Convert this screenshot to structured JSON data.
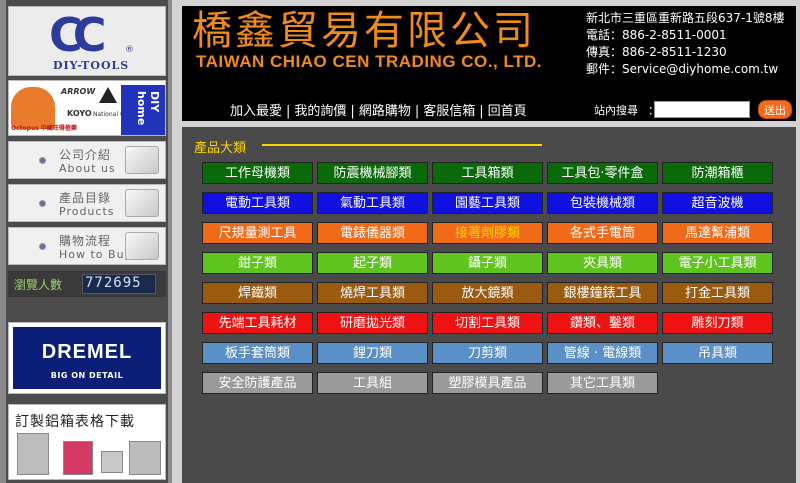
{
  "sidebar": {
    "logo_text": "DIY-TOOLS",
    "logo_mark": "CC",
    "logo_reg": "®",
    "brands": {
      "octopus": "Octopus 中國旺得蓓樂",
      "arrow": "ARROW",
      "koyo": "KOYO",
      "national": "National 松下電工",
      "diyhome": "DIY home"
    },
    "menu": [
      {
        "zh": "公司介紹",
        "en": "About us"
      },
      {
        "zh": "產品目錄",
        "en": "Products"
      },
      {
        "zh": "購物流程",
        "en": "How to Buy"
      }
    ],
    "counter_label": "瀏覽人數",
    "counter_value": "772695",
    "dremel_word": "DREMEL",
    "dremel_sub": "BIG ON DETAIL",
    "case_title": "訂製鋁箱表格下載"
  },
  "header": {
    "title_zh": "橋鑫貿易有限公司",
    "title_en": "TAIWAN CHIAO CEN TRADING CO., LTD.",
    "contact": [
      "新北市三重區重新路五段637-1號8樓",
      "電話：886-2-8511-0001",
      "傳真：886-2-8511-1230",
      "郵件：Service@diyhome.com.tw"
    ],
    "nav": [
      "加入最愛",
      "我的詢價",
      "網路購物",
      "客服信箱",
      "回首頁"
    ],
    "search_label": "站內搜尋",
    "search_colon": "：",
    "search_value": "",
    "search_button": "送出"
  },
  "content": {
    "category_title": "產品大類",
    "categories": [
      [
        "工作母機類",
        "防震機械腳類",
        "工具箱類",
        "工具包·零件盒",
        "防潮箱櫃"
      ],
      [
        "電動工具類",
        "氣動工具類",
        "園藝工具類",
        "包裝機械類",
        "超音波機"
      ],
      [
        "尺規量測工具",
        "電錶儀器類",
        "接著劑膠類",
        "各式手電筒",
        "馬達幫浦類"
      ],
      [
        "鉗子類",
        "起子類",
        "鑷子類",
        "夾具類",
        "電子小工具類"
      ],
      [
        "焊鐵類",
        "燒焊工具類",
        "放大鏡類",
        "銀樓鐘錶工具",
        "打金工具類"
      ],
      [
        "先端工具耗材",
        "研磨拋光類",
        "切割工具類",
        "鑽類、鑿類",
        "雕刻刀類"
      ],
      [
        "板手套筒類",
        "鋰刀類",
        "刀剪類",
        "管線 · 電線類",
        "吊具類"
      ],
      [
        "安全防護產品",
        "工具組",
        "塑膠模具產品",
        "其它工具類"
      ]
    ],
    "row_colors": [
      "#0a6a0a",
      "#1010e0",
      "#f06a1a",
      "#5fc41e",
      "#9a5a10",
      "#ee1212",
      "#5b8fc8",
      "#9a9a9a"
    ],
    "highlight_color": "#ffd400"
  }
}
